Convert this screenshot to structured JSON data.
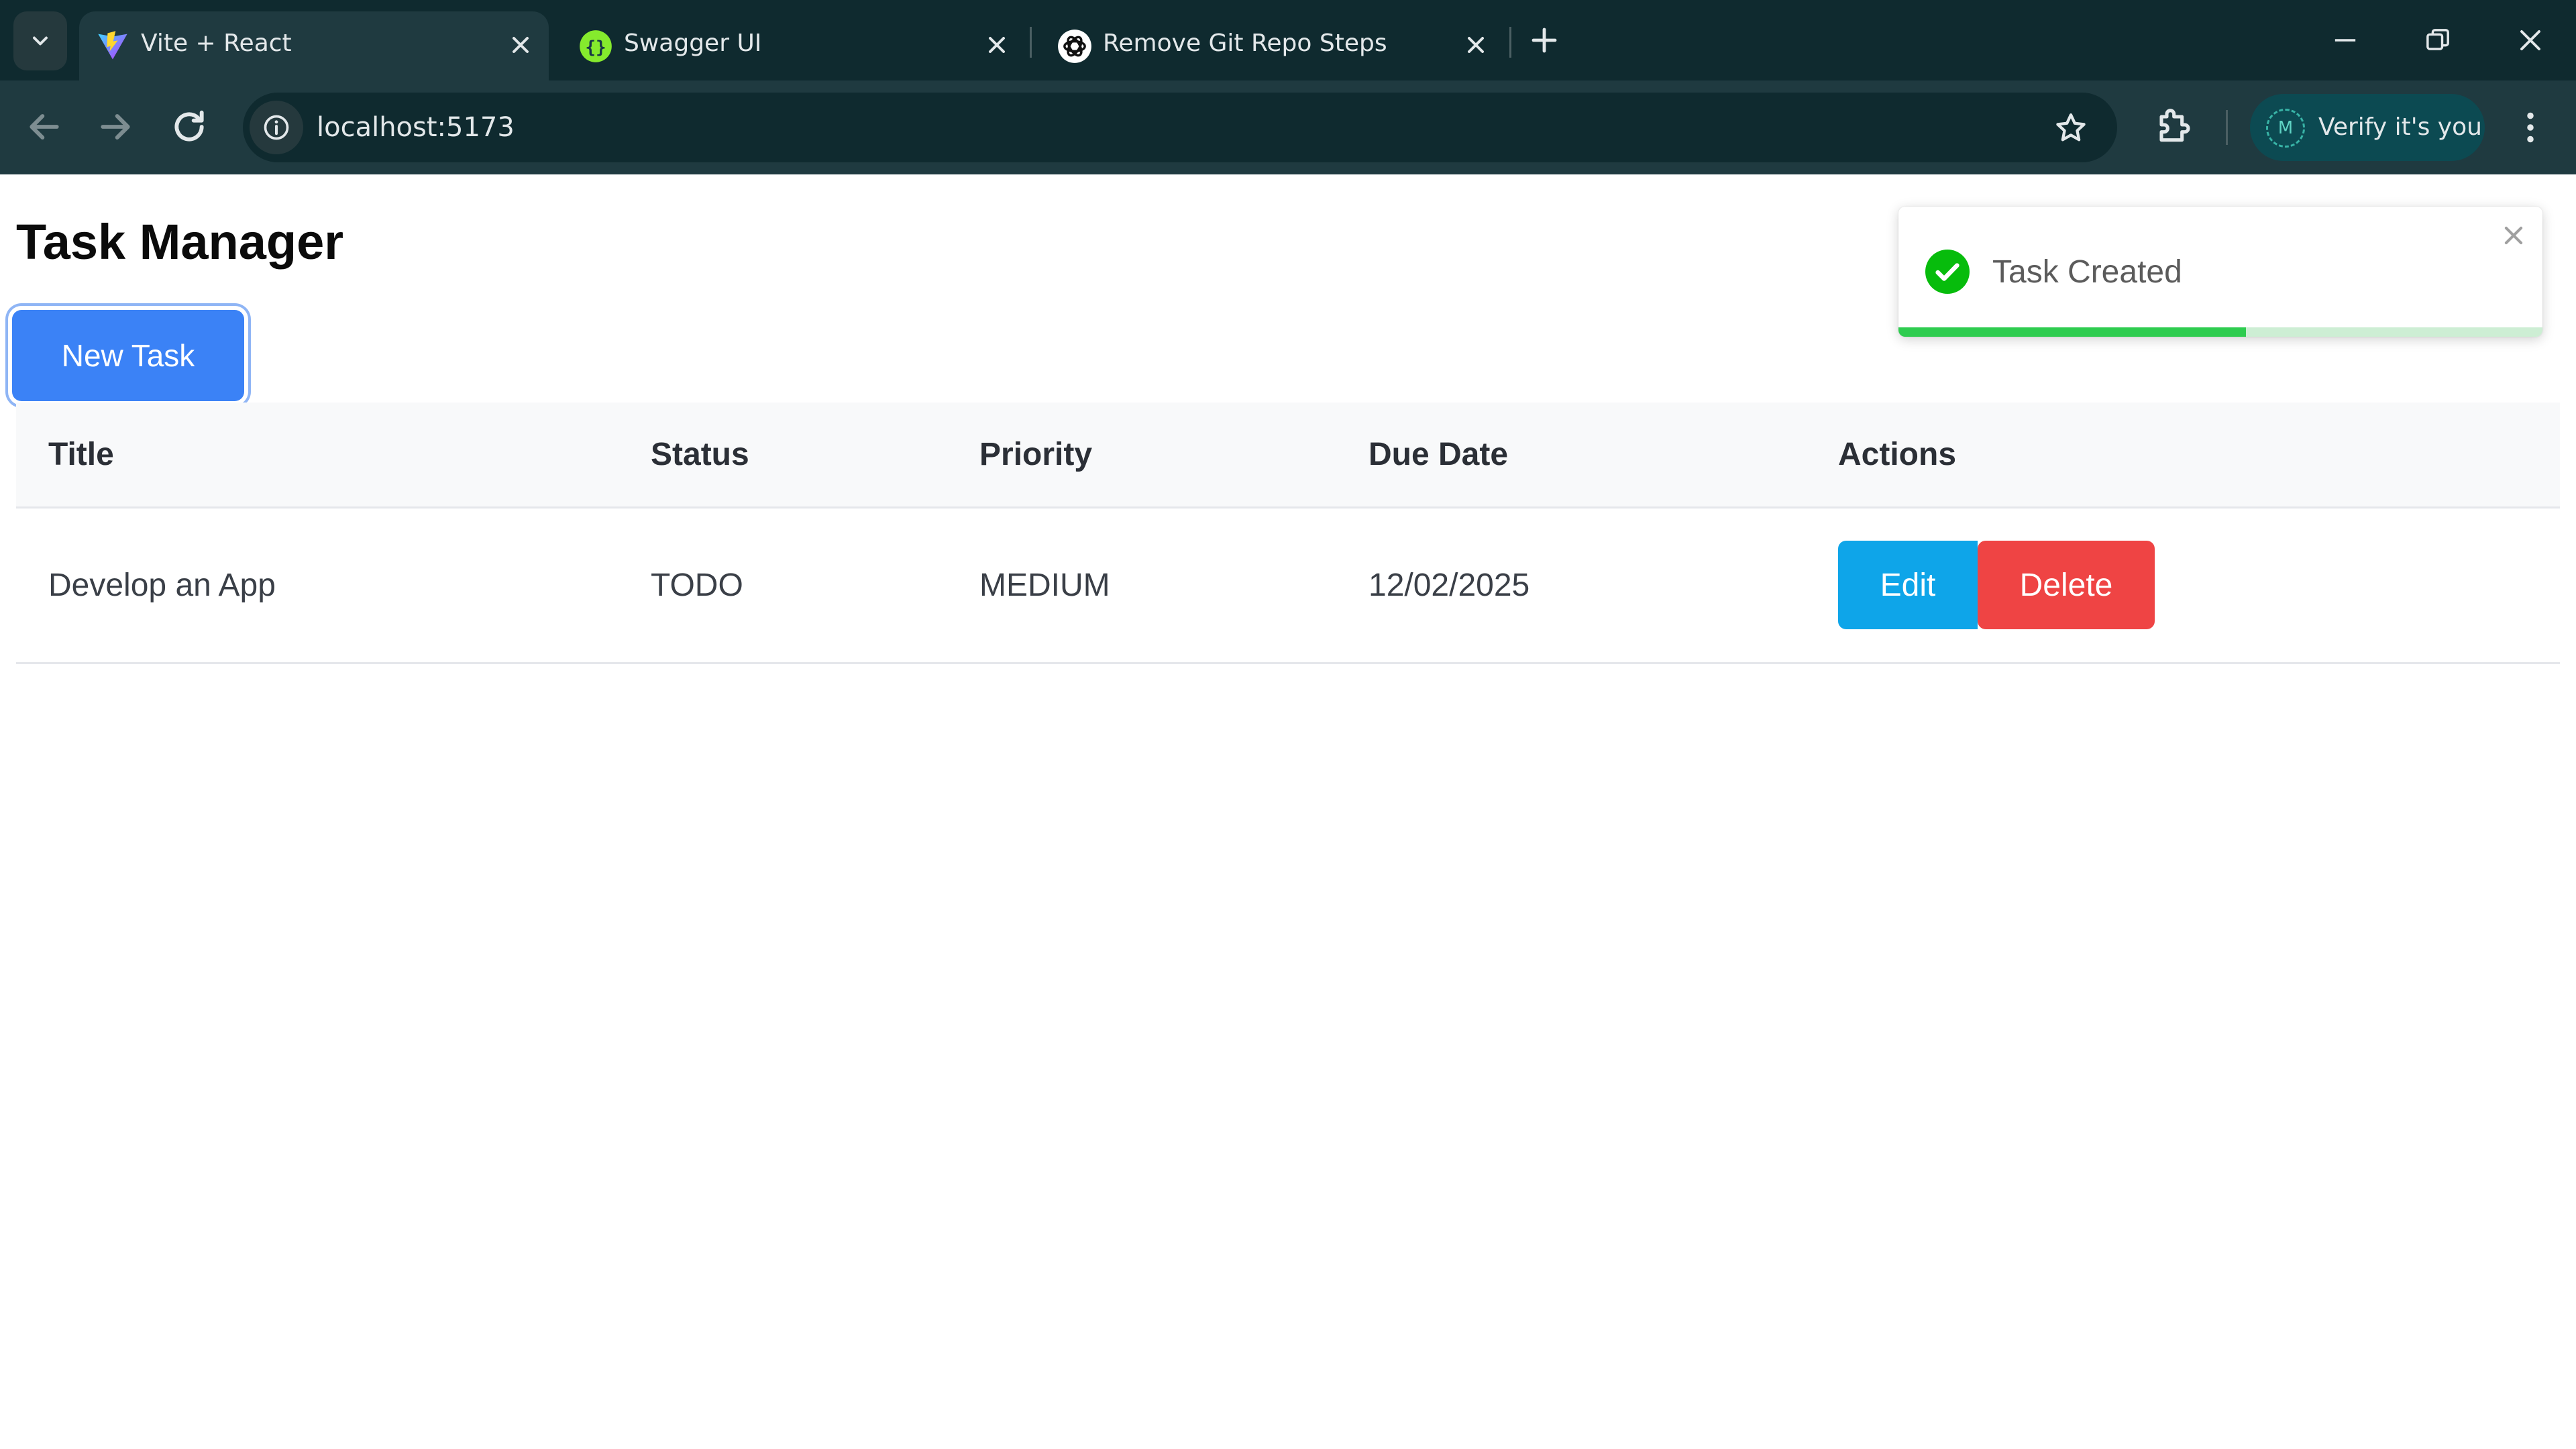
{
  "browser": {
    "tabs": [
      {
        "title": "Vite + React",
        "icon": "vite-icon",
        "active": true
      },
      {
        "title": "Swagger UI",
        "icon": "swagger-icon",
        "active": false
      },
      {
        "title": "Remove Git Repo Steps",
        "icon": "openai-icon",
        "active": false
      }
    ],
    "url": "localhost:5173",
    "profile": {
      "initial": "M",
      "label": "Verify it's you"
    }
  },
  "app": {
    "title": "Task Manager",
    "new_task_label": "New Task",
    "table": {
      "headers": [
        "Title",
        "Status",
        "Priority",
        "Due Date",
        "Actions"
      ],
      "rows": [
        {
          "title": "Develop an App",
          "status": "TODO",
          "priority": "MEDIUM",
          "due_date": "12/02/2025"
        }
      ],
      "edit_label": "Edit",
      "delete_label": "Delete"
    }
  },
  "toast": {
    "message": "Task Created",
    "progress": 0.54,
    "type": "success"
  },
  "colors": {
    "primary": "#3b82f6",
    "edit": "#0ea5e9",
    "delete": "#ef4444",
    "success": "#2ecc4f"
  }
}
